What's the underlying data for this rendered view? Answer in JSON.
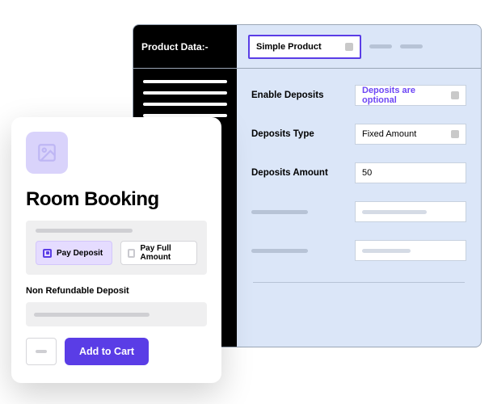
{
  "admin": {
    "header_label": "Product Data:-",
    "product_type": "Simple Product",
    "fields": {
      "enable_deposits": {
        "label": "Enable Deposits",
        "value": "Deposits are optional"
      },
      "deposits_type": {
        "label": "Deposits Type",
        "value": "Fixed Amount"
      },
      "deposits_amount": {
        "label": "Deposits Amount",
        "value": "50"
      }
    }
  },
  "product": {
    "title": "Room Booking",
    "options": {
      "deposit": "Pay Deposit",
      "full": "Pay Full Amount"
    },
    "non_refundable_label": "Non Refundable Deposit",
    "add_to_cart": "Add to Cart"
  }
}
